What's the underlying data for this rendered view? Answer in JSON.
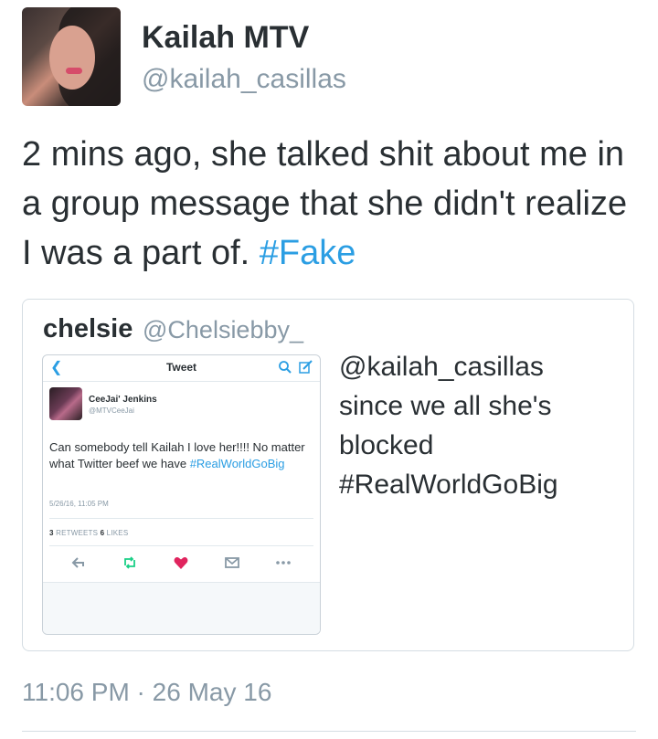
{
  "author": {
    "name": "Kailah MTV",
    "handle": "@kailah_casillas"
  },
  "tweet": {
    "text": "2 mins ago, she talked shit about me in a group message that she didn't realize I was a part of. ",
    "hashtag": "#Fake",
    "timestamp": "11:06 PM · 26 May 16"
  },
  "quoted": {
    "name": "chelsie",
    "handle": "@Chelsiebby_",
    "text_lines": [
      "@kailah_casillas",
      "since we all she's",
      "blocked",
      "#RealWorldGoBig"
    ]
  },
  "screenshot": {
    "back_icon": "chevron-left-icon",
    "title": "Tweet",
    "author_name": "CeeJai' Jenkins",
    "author_handle": "@MTVCeeJai",
    "text": "Can somebody tell Kailah I love her!!!! No matter what Twitter beef we have ",
    "hashtag": "#RealWorldGoBig",
    "date": "5/26/16, 11:05 PM",
    "retweets_count": "3",
    "retweets_label": "RETWEETS",
    "likes_count": "6",
    "likes_label": "LIKES",
    "icons": [
      "search-icon",
      "compose-icon",
      "reply-icon",
      "retweet-icon",
      "heart-icon",
      "dm-icon",
      "more-icon"
    ]
  },
  "colors": {
    "link": "#2b9ee3",
    "text": "#292f33",
    "muted": "#8899a6",
    "heart": "#e0245e",
    "retweet": "#19cf86"
  }
}
